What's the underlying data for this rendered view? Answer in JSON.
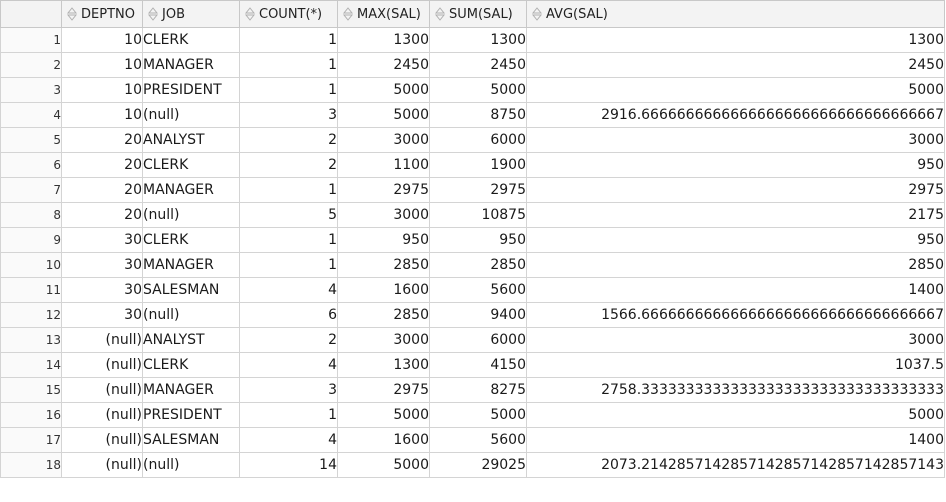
{
  "columns": [
    {
      "key": "deptno",
      "label": "DEPTNO"
    },
    {
      "key": "job",
      "label": "JOB"
    },
    {
      "key": "count",
      "label": "COUNT(*)"
    },
    {
      "key": "max",
      "label": "MAX(SAL)"
    },
    {
      "key": "sum",
      "label": "SUM(SAL)"
    },
    {
      "key": "avg",
      "label": "AVG(SAL)"
    }
  ],
  "rows": [
    {
      "n": "1",
      "deptno": "10",
      "job": "CLERK",
      "count": "1",
      "max": "1300",
      "sum": "1300",
      "avg": "1300"
    },
    {
      "n": "2",
      "deptno": "10",
      "job": "MANAGER",
      "count": "1",
      "max": "2450",
      "sum": "2450",
      "avg": "2450"
    },
    {
      "n": "3",
      "deptno": "10",
      "job": "PRESIDENT",
      "count": "1",
      "max": "5000",
      "sum": "5000",
      "avg": "5000"
    },
    {
      "n": "4",
      "deptno": "10",
      "job": "(null)",
      "count": "3",
      "max": "5000",
      "sum": "8750",
      "avg": "2916.6666666666666666666666666666666667"
    },
    {
      "n": "5",
      "deptno": "20",
      "job": "ANALYST",
      "count": "2",
      "max": "3000",
      "sum": "6000",
      "avg": "3000"
    },
    {
      "n": "6",
      "deptno": "20",
      "job": "CLERK",
      "count": "2",
      "max": "1100",
      "sum": "1900",
      "avg": "950"
    },
    {
      "n": "7",
      "deptno": "20",
      "job": "MANAGER",
      "count": "1",
      "max": "2975",
      "sum": "2975",
      "avg": "2975"
    },
    {
      "n": "8",
      "deptno": "20",
      "job": "(null)",
      "count": "5",
      "max": "3000",
      "sum": "10875",
      "avg": "2175"
    },
    {
      "n": "9",
      "deptno": "30",
      "job": "CLERK",
      "count": "1",
      "max": "950",
      "sum": "950",
      "avg": "950"
    },
    {
      "n": "10",
      "deptno": "30",
      "job": "MANAGER",
      "count": "1",
      "max": "2850",
      "sum": "2850",
      "avg": "2850"
    },
    {
      "n": "11",
      "deptno": "30",
      "job": "SALESMAN",
      "count": "4",
      "max": "1600",
      "sum": "5600",
      "avg": "1400"
    },
    {
      "n": "12",
      "deptno": "30",
      "job": "(null)",
      "count": "6",
      "max": "2850",
      "sum": "9400",
      "avg": "1566.6666666666666666666666666666666667"
    },
    {
      "n": "13",
      "deptno": "(null)",
      "job": "ANALYST",
      "count": "2",
      "max": "3000",
      "sum": "6000",
      "avg": "3000"
    },
    {
      "n": "14",
      "deptno": "(null)",
      "job": "CLERK",
      "count": "4",
      "max": "1300",
      "sum": "4150",
      "avg": "1037.5"
    },
    {
      "n": "15",
      "deptno": "(null)",
      "job": "MANAGER",
      "count": "3",
      "max": "2975",
      "sum": "8275",
      "avg": "2758.3333333333333333333333333333333333"
    },
    {
      "n": "16",
      "deptno": "(null)",
      "job": "PRESIDENT",
      "count": "1",
      "max": "5000",
      "sum": "5000",
      "avg": "5000"
    },
    {
      "n": "17",
      "deptno": "(null)",
      "job": "SALESMAN",
      "count": "4",
      "max": "1600",
      "sum": "5600",
      "avg": "1400"
    },
    {
      "n": "18",
      "deptno": "(null)",
      "job": "(null)",
      "count": "14",
      "max": "5000",
      "sum": "29025",
      "avg": "2073.2142857142857142857142857142857143"
    }
  ],
  "icons": {
    "sort": "sort-arrows-icon"
  },
  "colors": {
    "header_bg": "#f3f3f3",
    "grid_line": "#d4d4d4",
    "sort_icon": "#b0b0b0"
  }
}
